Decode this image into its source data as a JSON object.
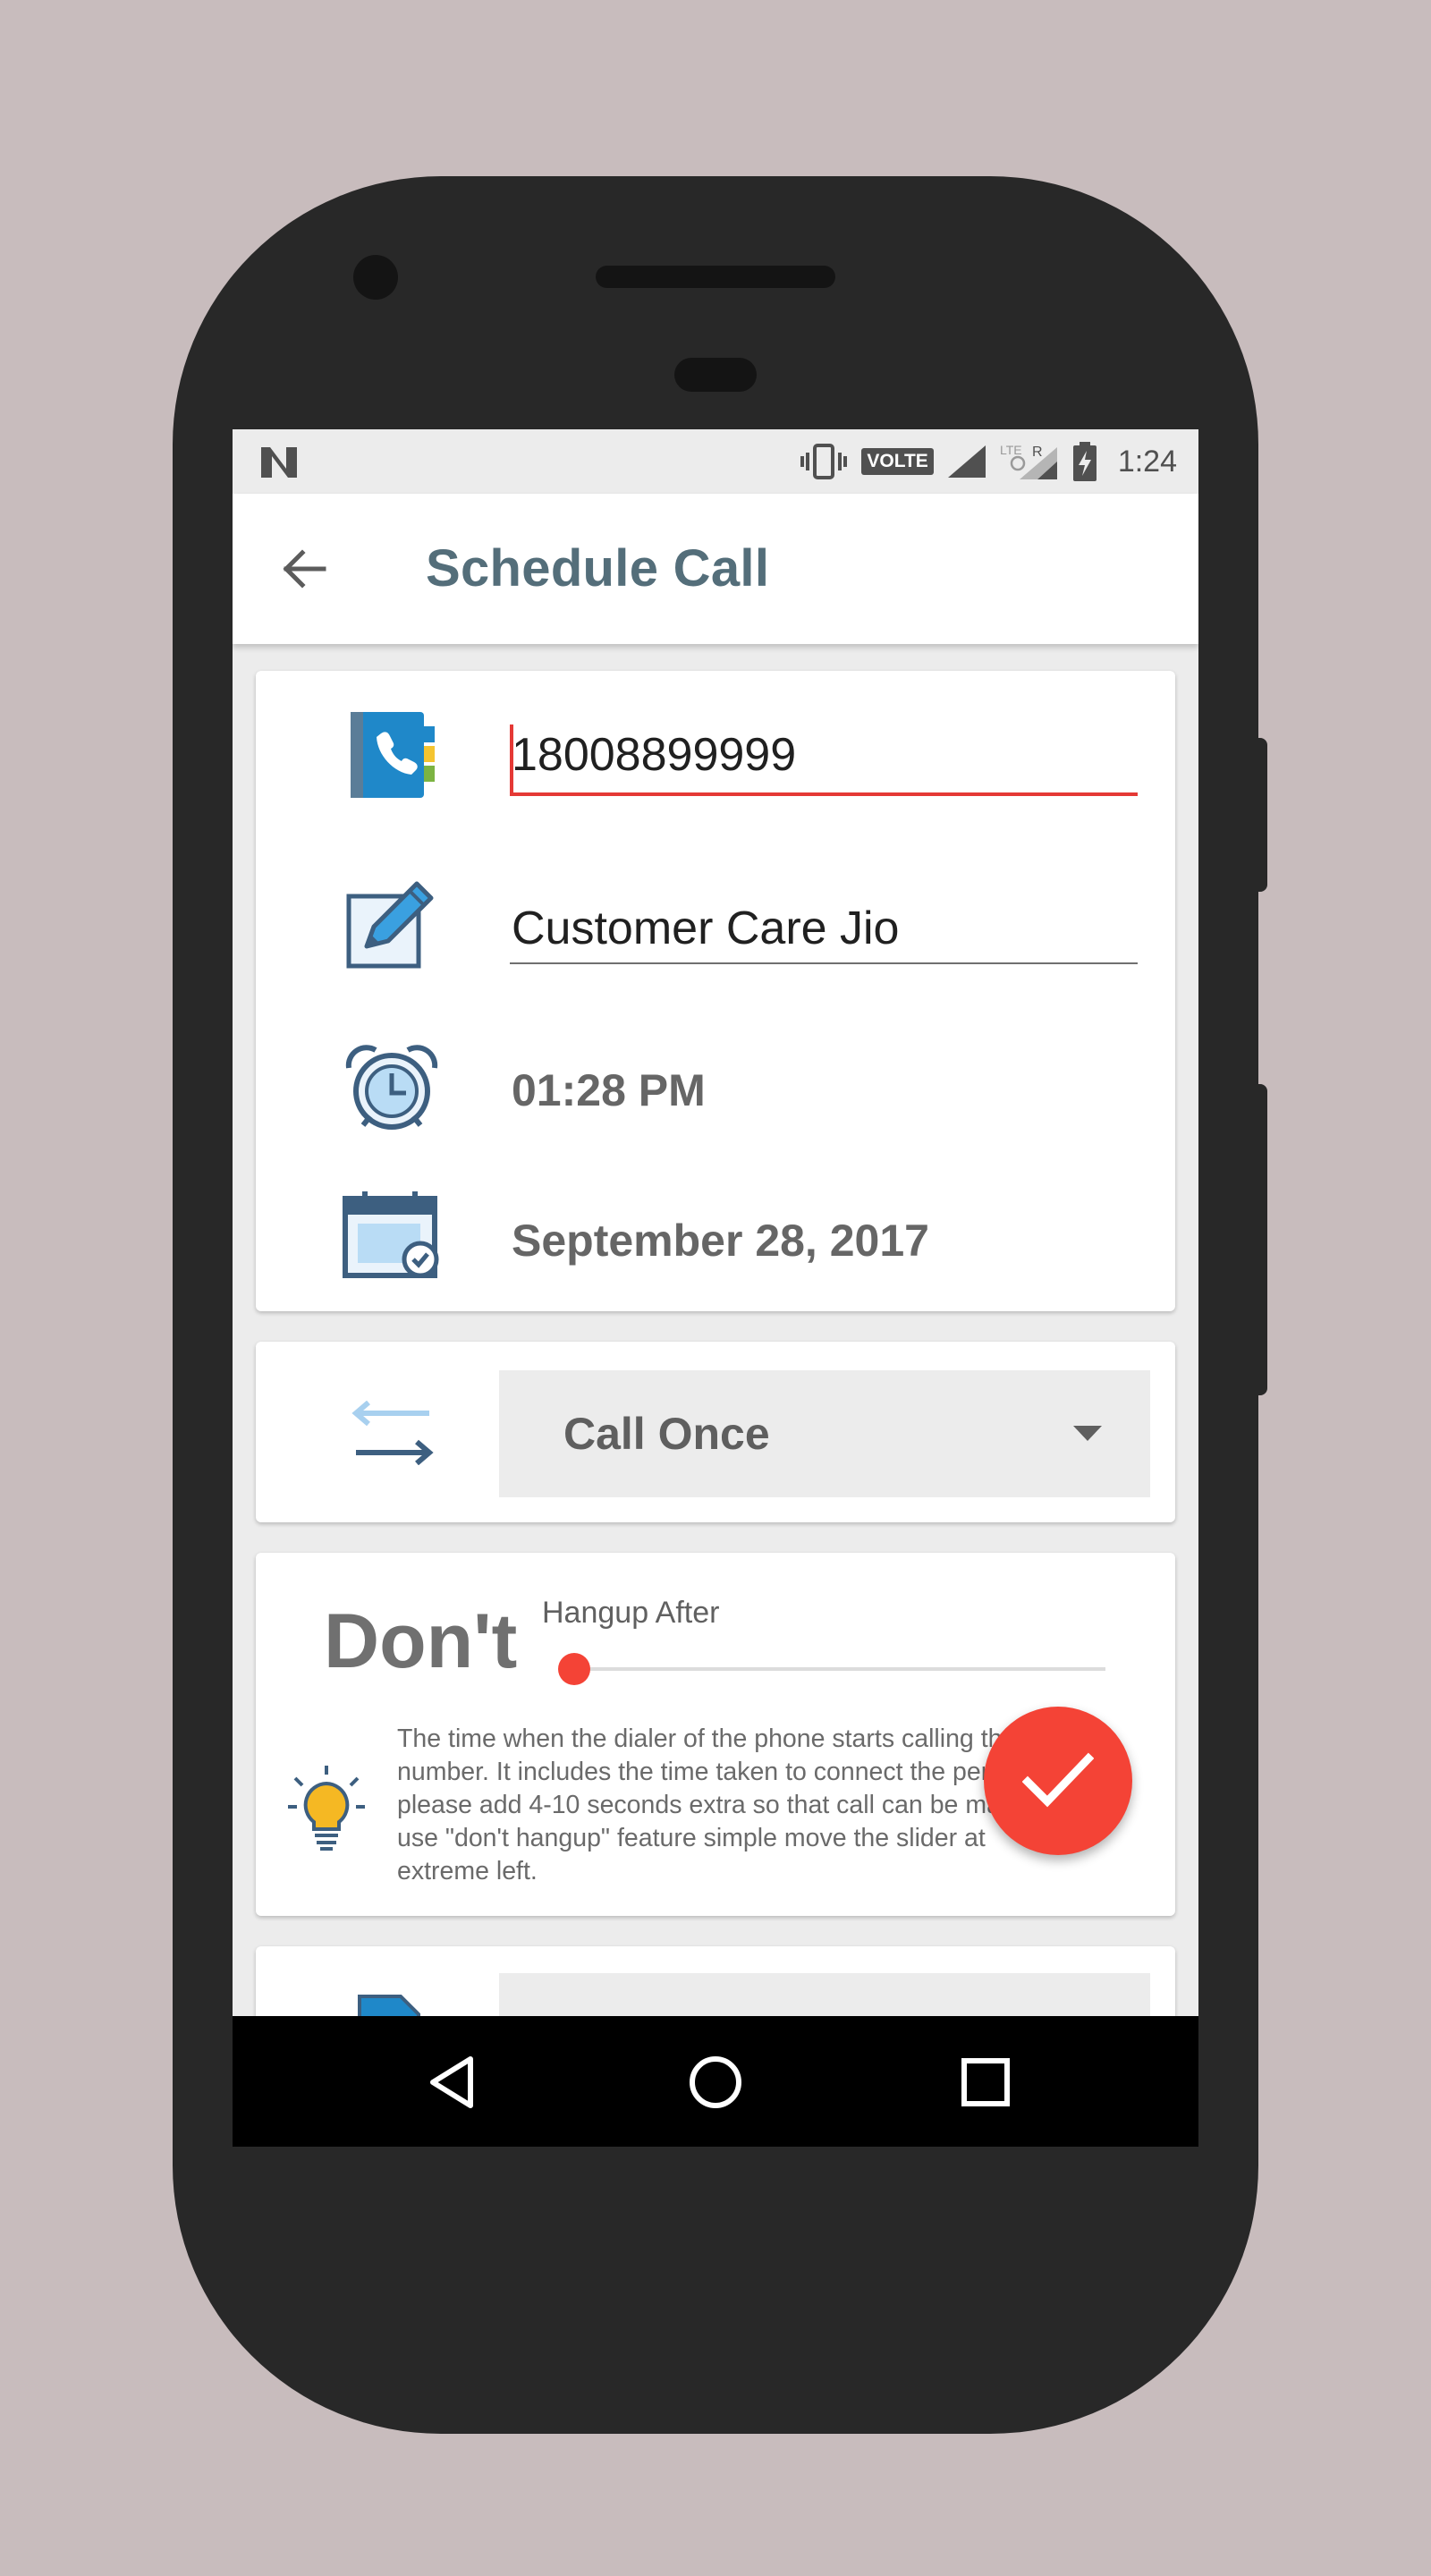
{
  "status_bar": {
    "notification_icon": "n-icon",
    "volte_label": "VOLTE",
    "time": "1:24",
    "icons": [
      "vibrate-icon",
      "signal-icon",
      "signal-roaming-icon",
      "battery-charging-icon"
    ]
  },
  "toolbar": {
    "title": "Schedule Call",
    "back_icon": "arrow-back-icon"
  },
  "form": {
    "phone_number": "18008899999",
    "call_name": "Customer Care Jio",
    "time": "01:28 PM",
    "date": "September 28, 2017"
  },
  "repeat": {
    "selected": "Call Once"
  },
  "hangup": {
    "value_label": "Don't",
    "title": "Hangup After",
    "slider_value": 0,
    "hint": "The time when the dialer of the phone starts calling the number. It includes the time taken to connect the person. So please add 4-10 seconds extra so that call can be made. To use \"don't hangup\" feature simple move the slider at extreme left."
  },
  "fab": {
    "icon": "check-icon"
  },
  "colors": {
    "accent": "#f44336",
    "title": "#546e7a",
    "background": "#c8bcbd"
  }
}
